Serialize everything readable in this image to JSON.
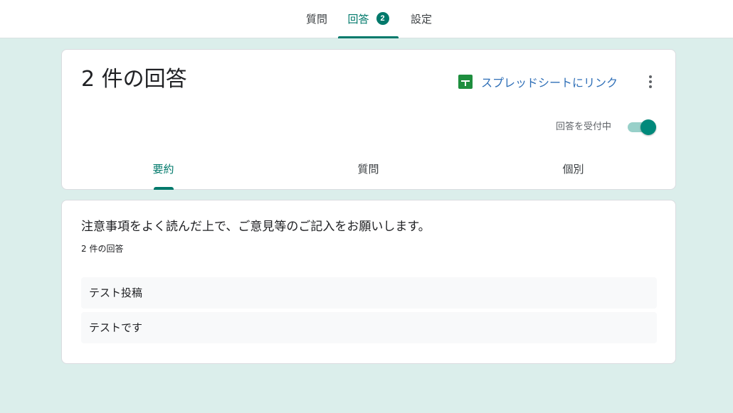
{
  "top_tabs": {
    "questions": "質問",
    "responses": "回答",
    "responses_badge": "2",
    "settings": "設定"
  },
  "header": {
    "title": "2 件の回答",
    "sheet_link_label": "スプレッドシートにリンク",
    "accepting_label": "回答を受付中",
    "accepting_responses": true
  },
  "sub_tabs": {
    "summary": "要約",
    "question": "質問",
    "individual": "個別",
    "active": "summary"
  },
  "question_card": {
    "title": "注意事項をよく読んだ上で、ご意見等のご記入をお願いします。",
    "response_count": "2 件の回答",
    "answers": [
      "テスト投稿",
      "テストです"
    ]
  },
  "colors": {
    "accent": "#00796b",
    "background": "#dbeeeb",
    "sheets_green": "#1e8e3e",
    "link_blue": "#2f6fb7"
  },
  "icons": {
    "sheets": "google-sheets-icon",
    "more": "more-vert-icon"
  }
}
